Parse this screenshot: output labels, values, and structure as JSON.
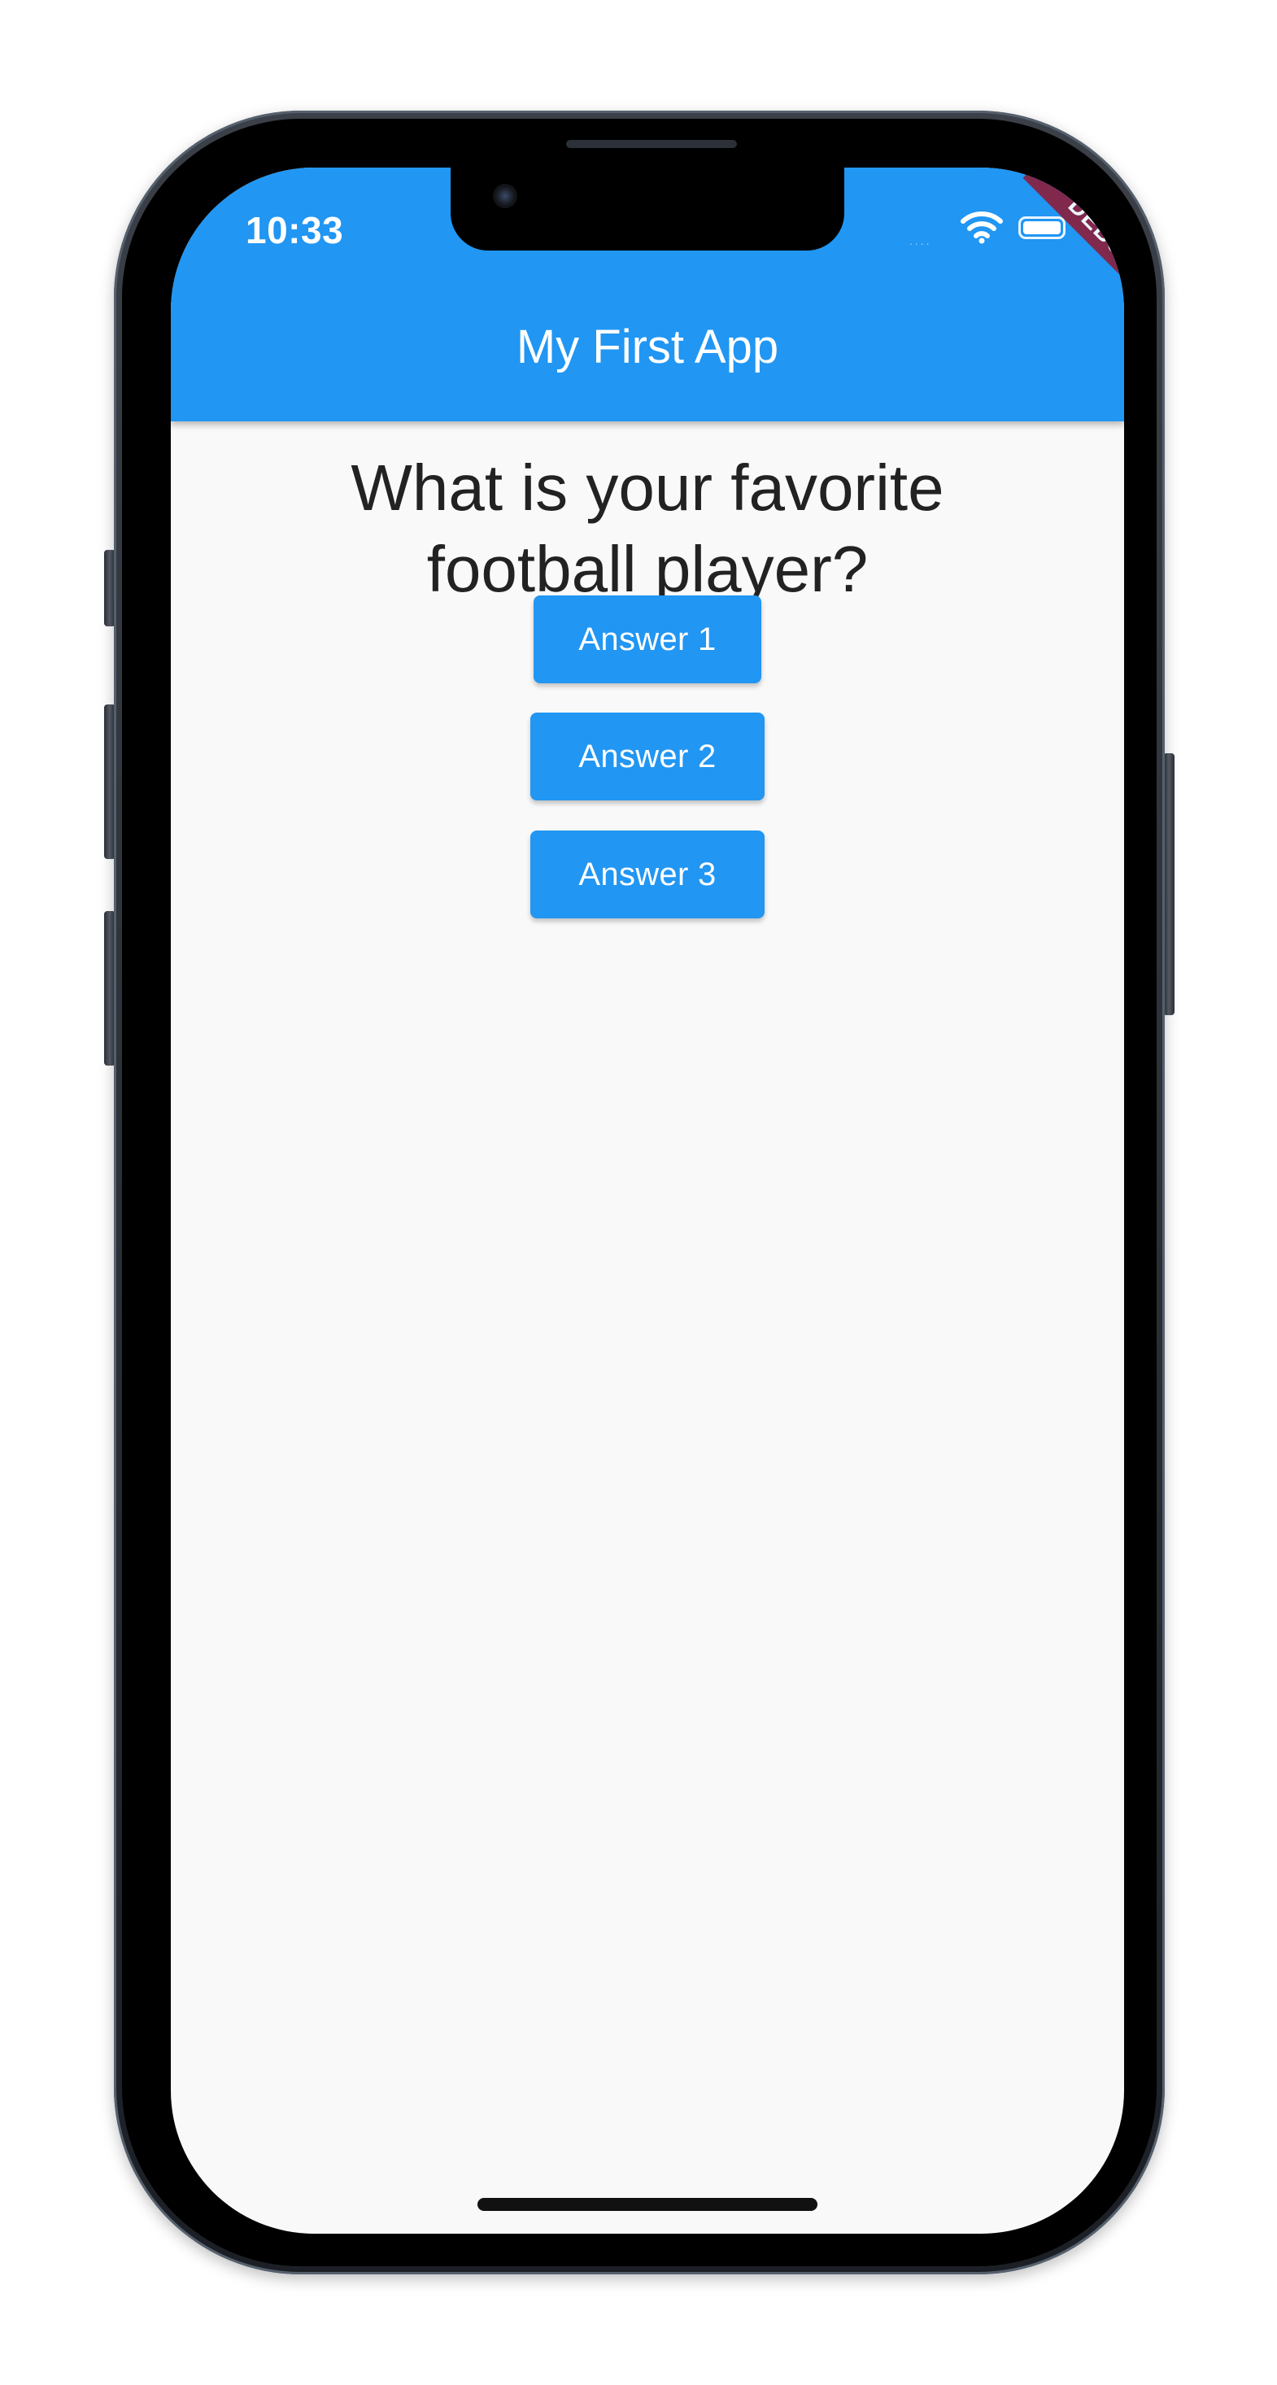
{
  "status_bar": {
    "time": "10:33",
    "signal_dots": "....",
    "wifi_icon": "wifi-icon",
    "battery_icon": "battery-icon"
  },
  "debug_banner": "DEBUG",
  "app_bar": {
    "title": "My First App",
    "color": "#2196f3"
  },
  "question": "What is your favorite football player?",
  "answers": [
    {
      "label": "Answer 1"
    },
    {
      "label": "Answer 2"
    },
    {
      "label": "Answer 3"
    }
  ],
  "colors": {
    "primary": "#2196f3",
    "background": "#f9f9f9",
    "debug_banner": "#8a1f3f",
    "question_text": "#222222"
  }
}
